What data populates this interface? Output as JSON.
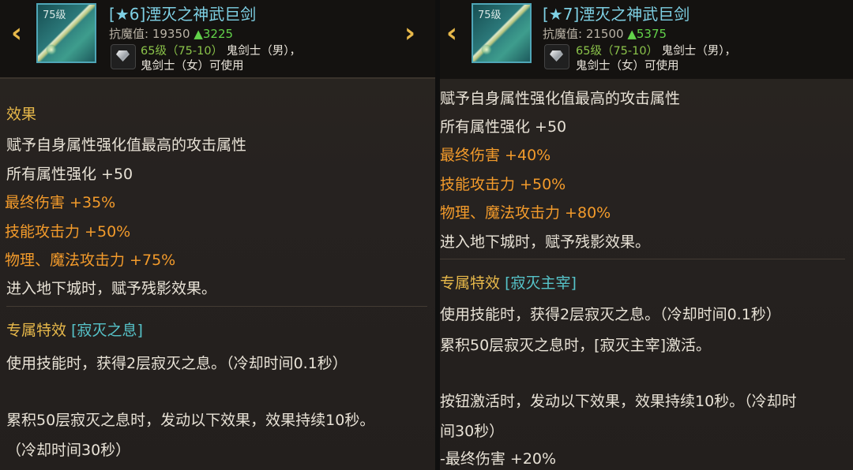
{
  "left": {
    "title": "[★6]湮灭之神武巨剑",
    "icon_level": "75级",
    "resist_label": "抗魔值:",
    "resist_value": "19350",
    "resist_up": "▲3225",
    "req_level": "65级（75-10）",
    "req_line1": "鬼剑士（男），",
    "req_line2": "鬼剑士（女）可使用",
    "effect_header": "效果",
    "lines": [
      {
        "plain": "赋予自身属性强化值最高的攻击属性"
      },
      {
        "plain": "所有属性强化 +50"
      },
      {
        "name": "最终伤害",
        "value": " +35%"
      },
      {
        "name": "技能攻击力",
        "value": " +50%"
      },
      {
        "name": "物理、魔法攻击力",
        "value": " +75%"
      },
      {
        "plain": "进入地下城时，赋予残影效果。"
      }
    ],
    "special_label": "专属特效",
    "special_name": "[寂灭之息]",
    "special_lines": [
      "使用技能时，获得2层寂灭之息。（冷却时间0.1秒）",
      "累积50层寂灭之息时，发动以下效果，效果持续10秒。",
      "（冷却时间30秒）"
    ]
  },
  "right": {
    "title": "[★7]湮灭之神武巨剑",
    "icon_level": "75级",
    "resist_label": "抗魔值:",
    "resist_value": "21500",
    "resist_up": "▲5375",
    "req_level": "65级（75-10）",
    "req_line1": "鬼剑士（男），",
    "req_line2": "鬼剑士（女）可使用",
    "lines": [
      {
        "plain": "赋予自身属性强化值最高的攻击属性"
      },
      {
        "plain": "所有属性强化 +50"
      },
      {
        "name": "最终伤害",
        "value": " +40%"
      },
      {
        "name": "技能攻击力",
        "value": " +50%"
      },
      {
        "name": "物理、魔法攻击力",
        "value": " +80%"
      },
      {
        "plain": "进入地下城时，赋予残影效果。"
      }
    ],
    "special_label": "专属特效",
    "special_name": "[寂灭主宰]",
    "special_lines": [
      "使用技能时，获得2层寂灭之息。（冷却时间0.1秒）",
      "累积50层寂灭之息时，[寂灭主宰]激活。",
      "按钮激活时，发动以下效果，效果持续10秒。（冷却时",
      "间30秒）",
      "-最终伤害 +20%"
    ]
  },
  "nav": {
    "prev": "‹",
    "next": "›"
  },
  "colors": {
    "title": "#7ed0e4",
    "gold": "#e7b84a",
    "orange": "#f39b2b",
    "green": "#62d24a",
    "cyan": "#56c3c9"
  }
}
